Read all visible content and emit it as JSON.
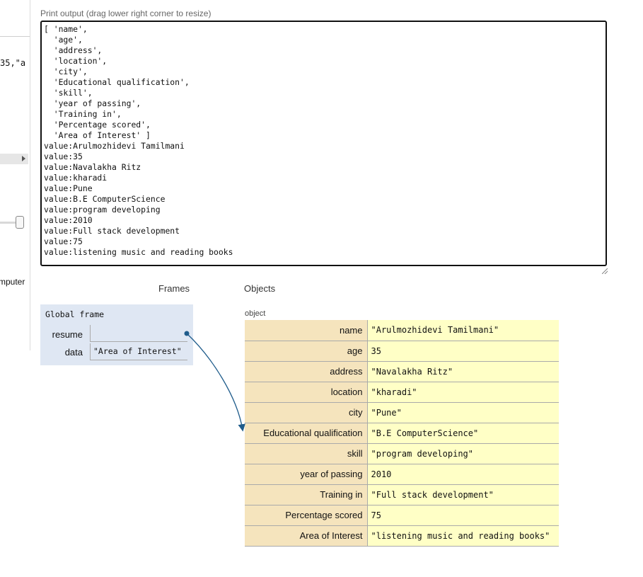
{
  "left_pane": {
    "code_fragment": "35,\"a",
    "clipped_text": "mputer"
  },
  "print_output": {
    "label": "Print output (drag lower right corner to resize)",
    "lines": [
      "[ 'name',",
      "  'age',",
      "  'address',",
      "  'location',",
      "  'city',",
      "  'Educational qualification',",
      "  'skill',",
      "  'year of passing',",
      "  'Training in',",
      "  'Percentage scored',",
      "  'Area of Interest' ]",
      "value:Arulmozhidevi Tamilmani",
      "value:35",
      "value:Navalakha Ritz",
      "value:kharadi",
      "value:Pune",
      "value:B.E ComputerScience",
      "value:program developing",
      "value:2010",
      "value:Full stack development",
      "value:75",
      "value:listening music and reading books"
    ]
  },
  "frames": {
    "heading": "Frames",
    "global_frame": {
      "title": "Global frame",
      "rows": [
        {
          "name": "resume",
          "value": ""
        },
        {
          "name": "data",
          "value": "\"Area of Interest\""
        }
      ]
    }
  },
  "objects": {
    "heading": "Objects",
    "type_label": "object",
    "entries": [
      {
        "key": "name",
        "value": "\"Arulmozhidevi Tamilmani\""
      },
      {
        "key": "age",
        "value": "35"
      },
      {
        "key": "address",
        "value": "\"Navalakha Ritz\""
      },
      {
        "key": "location",
        "value": "\"kharadi\""
      },
      {
        "key": "city",
        "value": "\"Pune\""
      },
      {
        "key": "Educational qualification",
        "value": "\"B.E ComputerScience\""
      },
      {
        "key": "skill",
        "value": "\"program developing\""
      },
      {
        "key": "year of passing",
        "value": "2010"
      },
      {
        "key": "Training in",
        "value": "\"Full stack development\""
      },
      {
        "key": "Percentage scored",
        "value": "75"
      },
      {
        "key": "Area of Interest",
        "value": "\"listening music and reading books\""
      }
    ]
  },
  "colors": {
    "frame_bg": "#dfe7f3",
    "key_bg": "#f5e4bd",
    "value_bg": "#ffffc6",
    "pointer": "#1f5c8b"
  }
}
